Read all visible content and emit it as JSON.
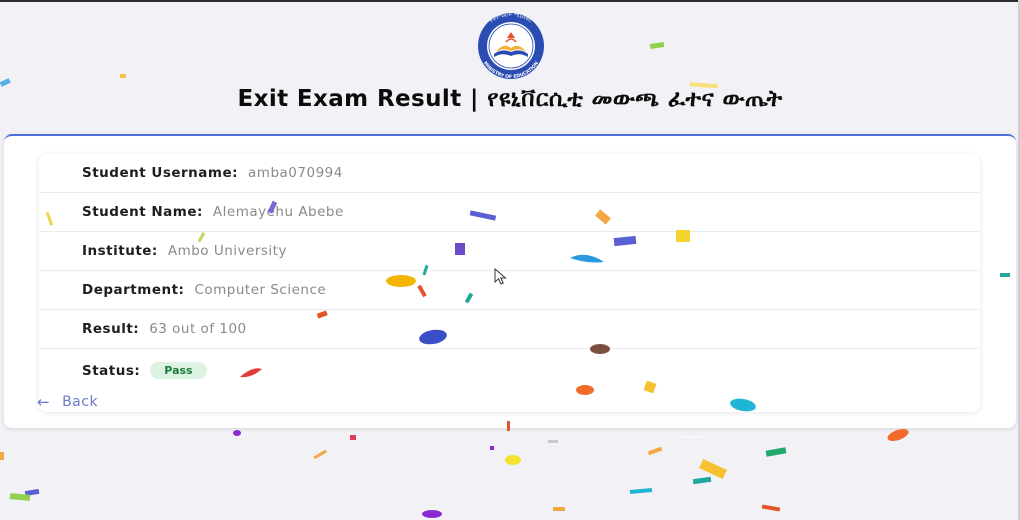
{
  "logo": {
    "top_text": "የትምህርት ሚኒስቴር",
    "bottom_text": "MINISTRY OF EDUCATION",
    "ring_color": "#2b4db3",
    "book_color": "#f2b233"
  },
  "page_title": "Exit Exam Result | የዩኒቨርሲቲ መውጫ ፈተና ውጤት",
  "result": {
    "username_label": "Student Username:",
    "username_value": "amba070994",
    "name_label": "Student Name:",
    "name_value": "Alemayehu Abebe",
    "institute_label": "Institute:",
    "institute_value": "Ambo University",
    "department_label": "Department:",
    "department_value": "Computer Science",
    "result_label": "Result:",
    "result_value": "63 out of 100",
    "status_label": "Status:",
    "status_value": "Pass"
  },
  "back_link": {
    "icon": "arrow-left-icon",
    "label": "Back"
  },
  "colors": {
    "accent": "#4a6fd6",
    "pass_badge_bg": "#dcf3e3",
    "pass_badge_text": "#1f7a3b",
    "link": "#6f79c9"
  }
}
